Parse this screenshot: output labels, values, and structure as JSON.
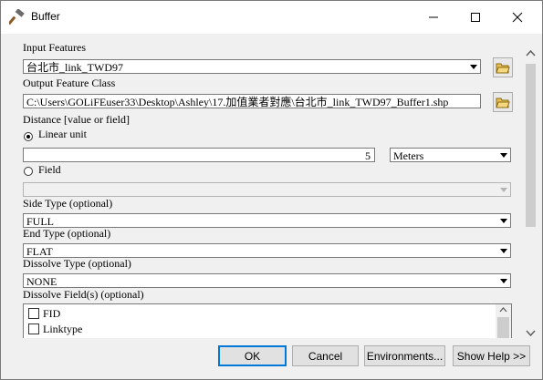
{
  "window": {
    "title": "Buffer",
    "icons": {
      "app": "hammer-icon",
      "minimize": "minimize-icon",
      "maximize": "maximize-icon",
      "close": "close-icon"
    }
  },
  "form": {
    "input_features": {
      "label": "Input Features",
      "value": "台北市_link_TWD97"
    },
    "output_feature_class": {
      "label": "Output Feature Class",
      "value": "C:\\Users\\GOLiFEuser33\\Desktop\\Ashley\\17.加值業者對應\\台北市_link_TWD97_Buffer1.shp"
    },
    "distance": {
      "label": "Distance [value or field]",
      "linear_unit_label": "Linear unit",
      "linear_unit_selected": true,
      "value": "5",
      "unit": "Meters",
      "field_label": "Field",
      "field_value": ""
    },
    "side_type": {
      "label": "Side Type (optional)",
      "value": "FULL"
    },
    "end_type": {
      "label": "End Type (optional)",
      "value": "FLAT"
    },
    "dissolve_type": {
      "label": "Dissolve Type (optional)",
      "value": "NONE"
    },
    "dissolve_fields": {
      "label": "Dissolve Field(s) (optional)",
      "items": [
        "FID",
        "Linktype"
      ]
    }
  },
  "buttons": {
    "ok": "OK",
    "cancel": "Cancel",
    "environments": "Environments...",
    "show_help": "Show Help >>"
  },
  "colors": {
    "default_button_border": "#0078d7",
    "window_bg": "#f0f0f0",
    "titlebar_bg": "#ffffff"
  }
}
